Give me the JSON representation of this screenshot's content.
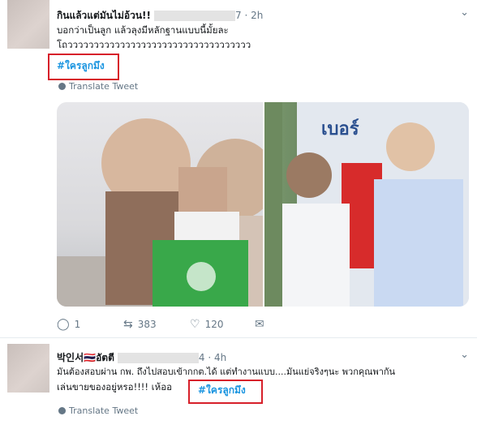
{
  "tweet1": {
    "name": "กินแล้วแต่มันไม่อ้วน!!",
    "handle_tail": "7",
    "time": "· 2h",
    "line1": "บอกว่าเป็นลูก แล้วลุงมีหลักฐานแบบนี้มั้ยละ",
    "line2": "โถววววววววววววววววววววววววววววววววววว",
    "hashtag": "#ใครลูกมึง",
    "translate": "Translate Tweet",
    "replies": "1",
    "retweets": "383",
    "likes": "120"
  },
  "tweet2": {
    "name": "박인서",
    "flag": "🇹🇭",
    "name2": "อัตตี",
    "handle_tail": "4",
    "time": "· 4h",
    "line1": "มันต้องสอบผ่าน กพ. ถึงไปสอบเข้ากกต.ได้ แต่ทำงานแบบ....มันแย่จริงๆนะ พวกคุณพากัน",
    "line2": "เล่นขายของอยู่หรอ!!!! เห้ออ",
    "hashtag": "#ใครลูกมึง",
    "translate": "Translate Tweet"
  },
  "icons": {
    "reply": "reply-icon",
    "retweet": "retweet-icon",
    "like": "like-icon",
    "dm": "message-icon",
    "caret": "chevron-down-icon"
  }
}
